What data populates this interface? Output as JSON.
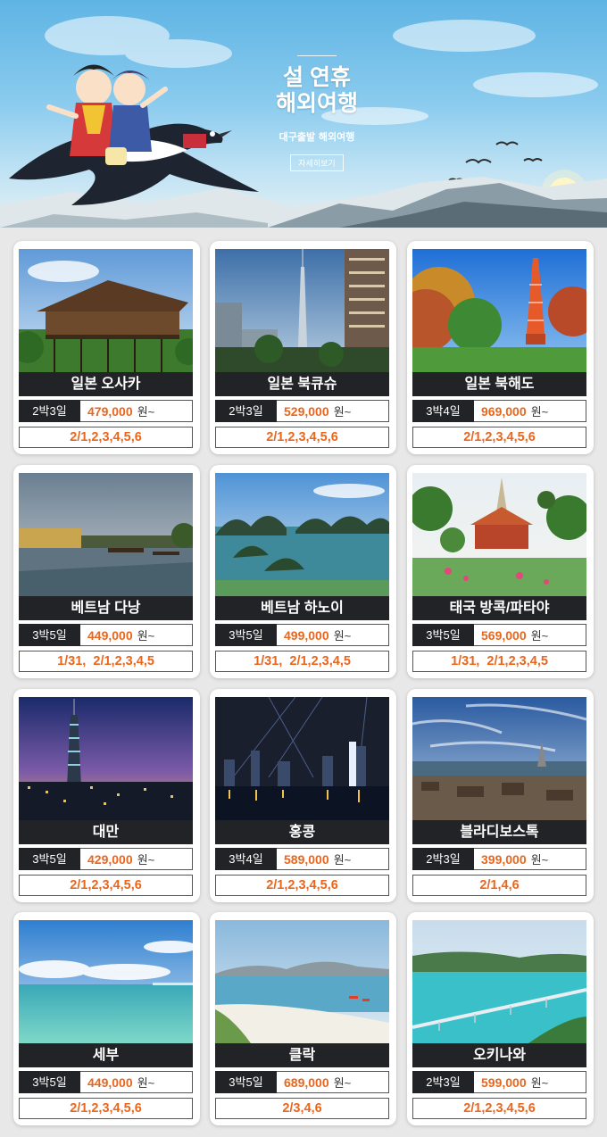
{
  "banner": {
    "title_line1": "설 연휴",
    "title_line2": "해외여행",
    "subtitle": "대구출발 해외여행",
    "button_label": "자세히보기"
  },
  "colors": {
    "accent_orange": "#e9661d",
    "dark_bar": "#222326",
    "background": "#e8e8e8"
  },
  "currency_suffix": "원~",
  "packages": [
    {
      "name": "일본 오사카",
      "nights": "2박3일",
      "price": "479,000",
      "dates": "2/1,2,3,4,5,6",
      "photo": "kiyomizu-temple-photo"
    },
    {
      "name": "일본 북큐슈",
      "nights": "2박3일",
      "price": "529,000",
      "dates": "2/1,2,3,4,5,6",
      "photo": "fukuoka-tower-photo"
    },
    {
      "name": "일본 북해도",
      "nights": "3박4일",
      "price": "969,000",
      "dates": "2/1,2,3,4,5,6",
      "photo": "sapporo-tv-tower-photo"
    },
    {
      "name": "베트남 다낭",
      "nights": "3박5일",
      "price": "449,000",
      "dates": "1/31,  2/1,2,3,4,5",
      "photo": "hoian-river-photo"
    },
    {
      "name": "베트남 하노이",
      "nights": "3박5일",
      "price": "499,000",
      "dates": "1/31,  2/1,2,3,4,5",
      "photo": "halong-bay-photo"
    },
    {
      "name": "태국 방콕/파타야",
      "nights": "3박5일",
      "price": "569,000",
      "dates": "1/31,  2/1,2,3,4,5",
      "photo": "wat-arun-photo"
    },
    {
      "name": "대만",
      "nights": "3박5일",
      "price": "429,000",
      "dates": "2/1,2,3,4,5,6",
      "photo": "taipei-101-night-photo"
    },
    {
      "name": "홍콩",
      "nights": "3박4일",
      "price": "589,000",
      "dates": "2/1,2,3,4,5,6",
      "photo": "hongkong-skyline-night-photo"
    },
    {
      "name": "블라디보스톡",
      "nights": "2박3일",
      "price": "399,000",
      "dates": "2/1,4,6",
      "photo": "vladivostok-bridge-photo"
    },
    {
      "name": "세부",
      "nights": "3박5일",
      "price": "449,000",
      "dates": "2/1,2,3,4,5,6",
      "photo": "cebu-sea-photo"
    },
    {
      "name": "클락",
      "nights": "3박5일",
      "price": "689,000",
      "dates": "2/3,4,6",
      "photo": "clark-beach-photo"
    },
    {
      "name": "오키나와",
      "nights": "2박3일",
      "price": "599,000",
      "dates": "2/1,2,3,4,5,6",
      "photo": "okinawa-kouri-bridge-photo"
    }
  ]
}
